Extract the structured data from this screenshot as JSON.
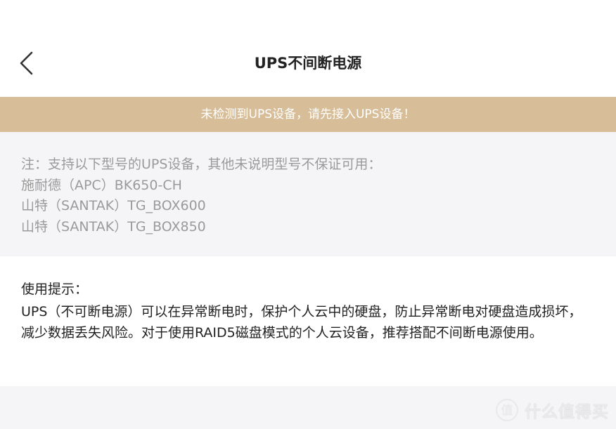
{
  "header": {
    "title": "UPS不间断电源",
    "back_icon": "chevron-left-icon"
  },
  "banner": {
    "text": "未检测到UPS设备，请先接入UPS设备！"
  },
  "models": {
    "items": [
      "注：支持以下型号的UPS设备，其他未说明型号不保证可用：",
      "施耐德（APC）BK650-CH",
      "山特（SANTAK）TG_BOX600",
      "山特（SANTAK）TG_BOX850"
    ]
  },
  "tips": {
    "title": "使用提示：",
    "body": "UPS（不可断电源）可以在异常断电时，保护个人云中的硬盘，防止异常断电对硬盘造成损坏，减少数据丢失风险。对于使用RAID5磁盘模式的个人云设备，推荐搭配不间断电源使用。"
  },
  "watermark": {
    "text": "什么值得买",
    "logo_icon": "smzdm-logo-icon"
  },
  "colors": {
    "banner_bg": "#d7bd98",
    "page_bg": "#f5f5f7",
    "muted_text": "#9a9a9a",
    "primary_text": "#222222"
  }
}
